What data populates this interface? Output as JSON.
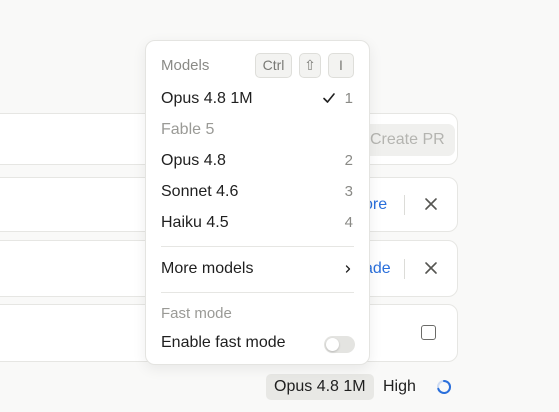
{
  "background_cards": {
    "create_pr_label": "Create PR",
    "link_1_label": "ore",
    "link_2_label": "ade"
  },
  "bottom_bar": {
    "model_label": "Opus 4.8 1M",
    "effort_label": "High"
  },
  "model_menu": {
    "header": "Models",
    "shortcut_keys": [
      "Ctrl",
      "⇧",
      "I"
    ],
    "models": [
      {
        "label": "Opus 4.8 1M",
        "shortcut": "1",
        "selected": true,
        "disabled": false
      },
      {
        "label": "Fable 5",
        "shortcut": "",
        "selected": false,
        "disabled": true
      },
      {
        "label": "Opus 4.8",
        "shortcut": "2",
        "selected": false,
        "disabled": false
      },
      {
        "label": "Sonnet 4.6",
        "shortcut": "3",
        "selected": false,
        "disabled": false
      },
      {
        "label": "Haiku 4.5",
        "shortcut": "4",
        "selected": false,
        "disabled": false
      }
    ],
    "more_models_label": "More models",
    "fast_mode_header": "Fast mode",
    "enable_fast_mode_label": "Enable fast mode",
    "fast_mode_enabled": false
  },
  "colors": {
    "accent_link": "#2a6fdb",
    "spinner": "#2a6fdb"
  },
  "icons": {
    "selected_check": "check-icon",
    "more_models": "chevron-right-icon",
    "dismiss": "close-icon",
    "status": "spinner-icon"
  }
}
